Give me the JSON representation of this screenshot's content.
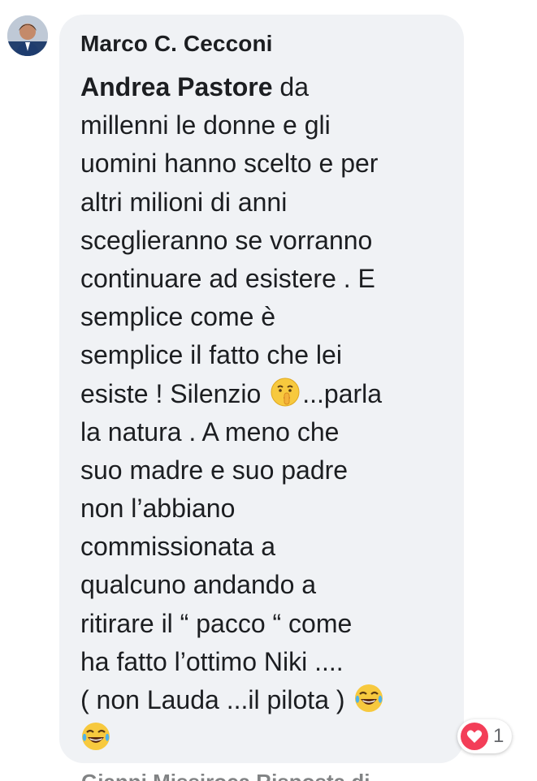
{
  "comment": {
    "author": "Marco C. Cecconi",
    "mention": "Andrea Pastore",
    "lines": [
      " da",
      "millenni le donne e gli",
      "uomini hanno scelto e per",
      "altri milioni di anni",
      "sceglieranno se vorranno",
      "continuare ad esistere . E",
      "semplice come è",
      "semplice il fatto che lei",
      "esiste ! Silenzio ",
      "...parla",
      "la natura . A meno che",
      "suo madre e suo padre",
      "non l’abbiano",
      "commissionata a",
      "qualcuno andando a",
      "ritirare il “ pacco “ come",
      "ha fatto l’ottimo Niki ....",
      "( non Lauda ...il pilota ) "
    ],
    "emojis": {
      "shush": "shushing-face-emoji",
      "laugh": "tears-of-joy-emoji"
    }
  },
  "reaction": {
    "type": "love",
    "count": "1",
    "color": "#f33e58"
  },
  "next_comment_preview": "Gianni Missiroca Risposta di"
}
